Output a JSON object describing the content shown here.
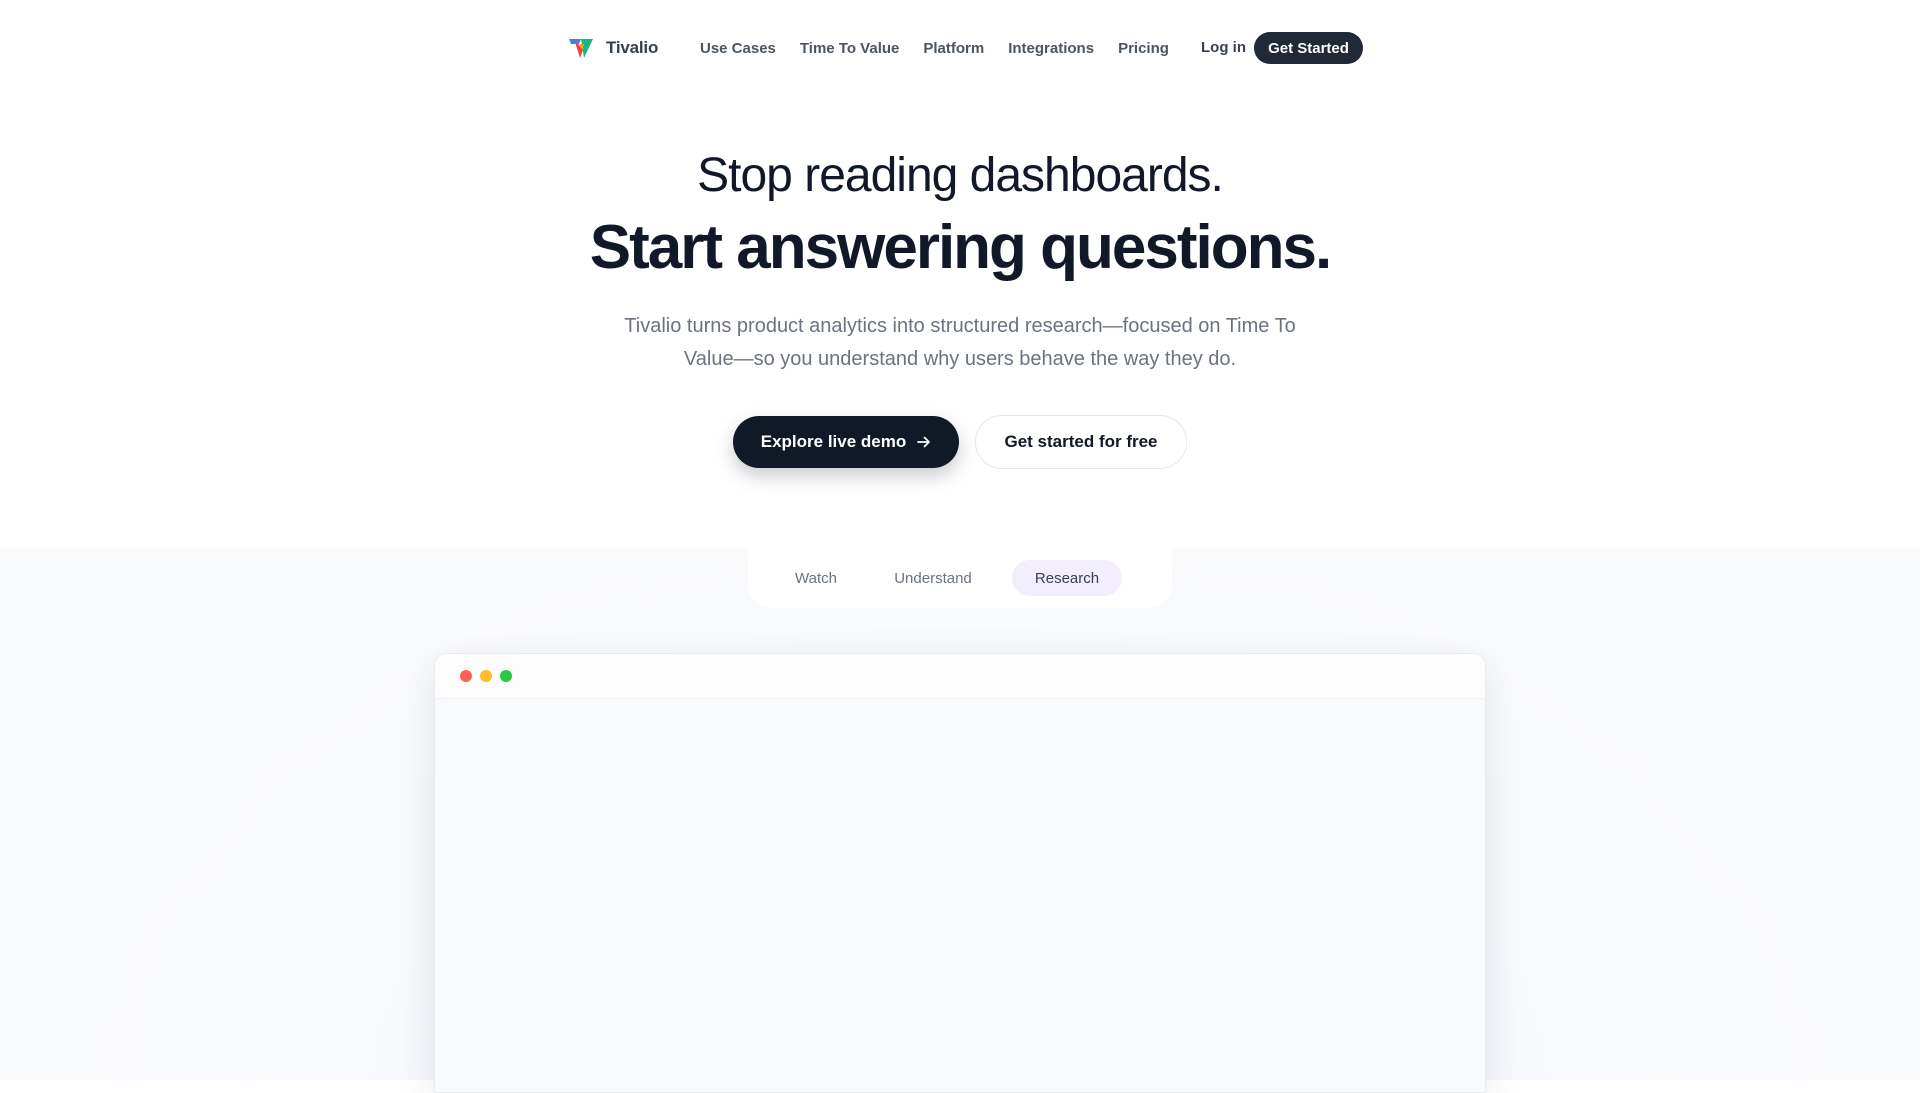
{
  "brand": {
    "name": "Tivalio",
    "logo_icon": "tivalio-logo-icon",
    "colors": [
      "#ef4444",
      "#f59e0b",
      "#3b82f6",
      "#10b981"
    ]
  },
  "nav": {
    "links": [
      "Use Cases",
      "Time To Value",
      "Platform",
      "Integrations",
      "Pricing"
    ],
    "login_label": "Log in",
    "cta_label": "Get Started"
  },
  "hero": {
    "headline_line1": "Stop reading dashboards.",
    "headline_line2": "Start answering questions.",
    "subtitle": "Tivalio turns product analytics into structured research—focused on Time To Value—so you understand why users behave the way they do.",
    "primary_button": "Explore live demo",
    "primary_button_icon": "arrow-right-icon",
    "secondary_button": "Get started for free"
  },
  "tabs": {
    "items": [
      "Watch",
      "Understand",
      "Research"
    ],
    "active": "Research"
  },
  "window": {
    "traffic_lights": [
      "#ff5f57",
      "#febc2e",
      "#28c840"
    ]
  },
  "theme": {
    "primary_dark": "#111827",
    "active_tab_bg": "#f3eefb"
  }
}
